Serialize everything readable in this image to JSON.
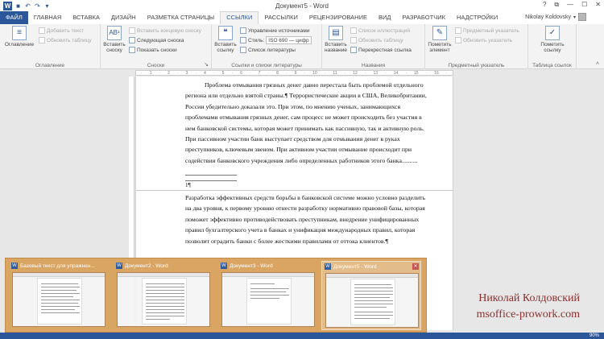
{
  "window": {
    "title": "Документ5 - Word",
    "help": "?",
    "restore": "⧉",
    "minimize": "—",
    "maximize": "☐",
    "close": "✕"
  },
  "tabs": {
    "file": "ФАЙЛ",
    "items": [
      "ГЛАВНАЯ",
      "ВСТАВКА",
      "ДИЗАЙН",
      "РАЗМЕТКА СТРАНИЦЫ",
      "ССЫЛКИ",
      "РАССЫЛКИ",
      "РЕЦЕНЗИРОВАНИЕ",
      "ВИД",
      "РАЗРАБОТЧИК",
      "НАДСТРОЙКИ"
    ],
    "active": "ССЫЛКИ"
  },
  "user": {
    "name": "Nikolay Koldovsky"
  },
  "ribbon": {
    "toc": {
      "button": "Оглавление",
      "add_text": "Добавить текст",
      "update_table": "Обновить таблицу",
      "label": "Оглавление"
    },
    "footnotes": {
      "insert": "Вставить сноску",
      "insert_endnote": "Вставить концевую сноску",
      "next_footnote": "Следующая сноска",
      "show_notes": "Показать сноски",
      "label": "Сноски"
    },
    "citations": {
      "insert": "Вставить ссылку",
      "manage_sources": "Управление источниками",
      "style_label": "Стиль:",
      "style_value": "ISO 690 — цифр",
      "bibliography": "Список литературы",
      "label": "Ссылки и списки литературы"
    },
    "captions": {
      "insert": "Вставить название",
      "table_of_figures": "Список иллюстраций",
      "update_table": "Обновить таблицу",
      "cross_reference": "Перекрестная ссылка",
      "label": "Названия"
    },
    "index": {
      "mark": "Пометить элемент",
      "insert_index": "Предметный указатель",
      "update_index": "Обновить указатель",
      "label": "Предметный указатель"
    },
    "authorities": {
      "mark_citation": "Пометить ссылку",
      "label": "Таблица ссылок"
    }
  },
  "document": {
    "footnote_lines": [
      "Проблема отмывания грязных денег давно перестала быть проблемой отдельного",
      "региона или отдельно взятой страны.¶ Террористические акции в США, Великобритании,",
      "России убедительно доказали это. При этом, по мнению ученых, занимающихся",
      "проблемами отмывания грязных денег, сам процесс не может происходить без участия в",
      "нем банковской системы, которая может принимать как пассивную, так и активную роль.",
      "При пассивном участии банк выступает средством для отмывания денег в руках",
      "преступников, ключевым звеном. При активном участии отмывание происходит при",
      "содействии банковского учреждения либо определенных работников этого банка.........."
    ],
    "separator_mark": "1¶",
    "body_lines": [
      "Разработка эффективных средств борьбы в банковской системе можно условно разделить",
      "на два уровня, к первому уровню отнести разработку нормативно правовой базы, которая",
      "поможет эффективно противодействовать преступникам, внедрение унифицированных",
      "правил бухгалтерского учета в банках и унификация международных правил, которая",
      "позволит оградить банки с более жесткими правилами от оттока клиентов.¶"
    ]
  },
  "thumbnails": [
    {
      "title": "Базовый текст для упражнен..."
    },
    {
      "title": "Документ2 - Word"
    },
    {
      "title": "Документ3 - Word"
    },
    {
      "title": "Документ5 - Word"
    }
  ],
  "watermark": {
    "line1": "Николай Колдовский",
    "line2": "msoffice-prowork.com"
  },
  "statusbar": {
    "zoom": "90%"
  },
  "colors": {
    "word_blue": "#2b579a",
    "thumb_bar": "#d9a35e",
    "watermark": "#8b2d2d"
  }
}
